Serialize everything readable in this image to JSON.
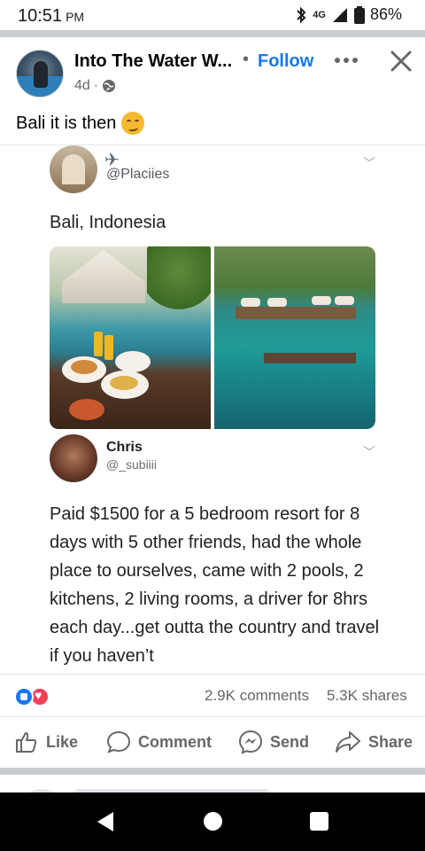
{
  "status_bar": {
    "time": "10:51",
    "ampm": "PM",
    "network": "4G",
    "battery": "86%"
  },
  "post": {
    "page_name": "Into The Water W...",
    "follow_label": "Follow",
    "age": "4d",
    "caption": "Bali it is then",
    "caption_emoji": "smirking-face"
  },
  "tweet1": {
    "handle": "@Placiies",
    "text": "Bali, Indonesia"
  },
  "tweet2": {
    "name": "Chris",
    "handle": "@_subiiii",
    "text": "Paid $1500 for a 5 bedroom resort for 8 days with 5 other friends, had the whole place to ourselves, came with 2 pools, 2 kitchens, 2 living rooms, a driver for 8hrs each day...get outta the country and travel if you haven’t"
  },
  "engagement": {
    "comments": "2.9K comments",
    "shares": "5.3K shares"
  },
  "actions": {
    "like": "Like",
    "comment": "Comment",
    "send": "Send",
    "share": "Share"
  },
  "colors": {
    "accent": "#1877f2",
    "love": "#f33e58",
    "secondary_text": "#65676b",
    "divider": "#c9ccd1"
  }
}
